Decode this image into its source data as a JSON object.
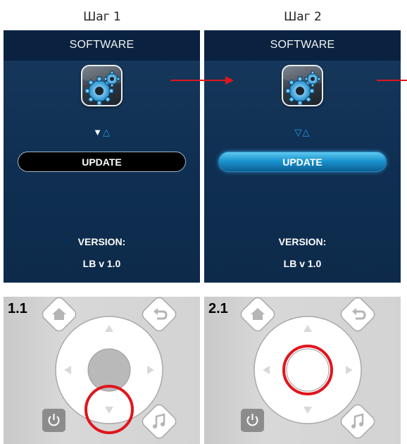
{
  "steps": [
    {
      "title": "Шаг 1",
      "screen": {
        "header": "SOFTWARE",
        "icon": "software-gears-icon",
        "arrows": {
          "down": "▼",
          "up": "△"
        },
        "button_label": "UPDATE",
        "button_state": "idle",
        "version_label": "VERSION:",
        "version_value": "LB v 1.0"
      },
      "remote": {
        "label": "1.1",
        "highlight": "down-arrow"
      }
    },
    {
      "title": "Шаг 2",
      "screen": {
        "header": "SOFTWARE",
        "icon": "software-gears-icon",
        "arrows": {
          "down": "▽",
          "up": "△"
        },
        "button_label": "UPDATE",
        "button_state": "selected",
        "version_label": "VERSION:",
        "version_value": "LB v 1.0"
      },
      "remote": {
        "label": "2.1",
        "highlight": "center-ok"
      }
    }
  ],
  "colors": {
    "screen_bg": "#0f2f52",
    "header_bg": "#0a2240",
    "accent_blue": "#1e9be8",
    "highlight_red": "#e0151d",
    "remote_bg": "#d3d3d3"
  },
  "remote_buttons": [
    "home-icon",
    "back-icon",
    "power-icon",
    "music-icon"
  ]
}
